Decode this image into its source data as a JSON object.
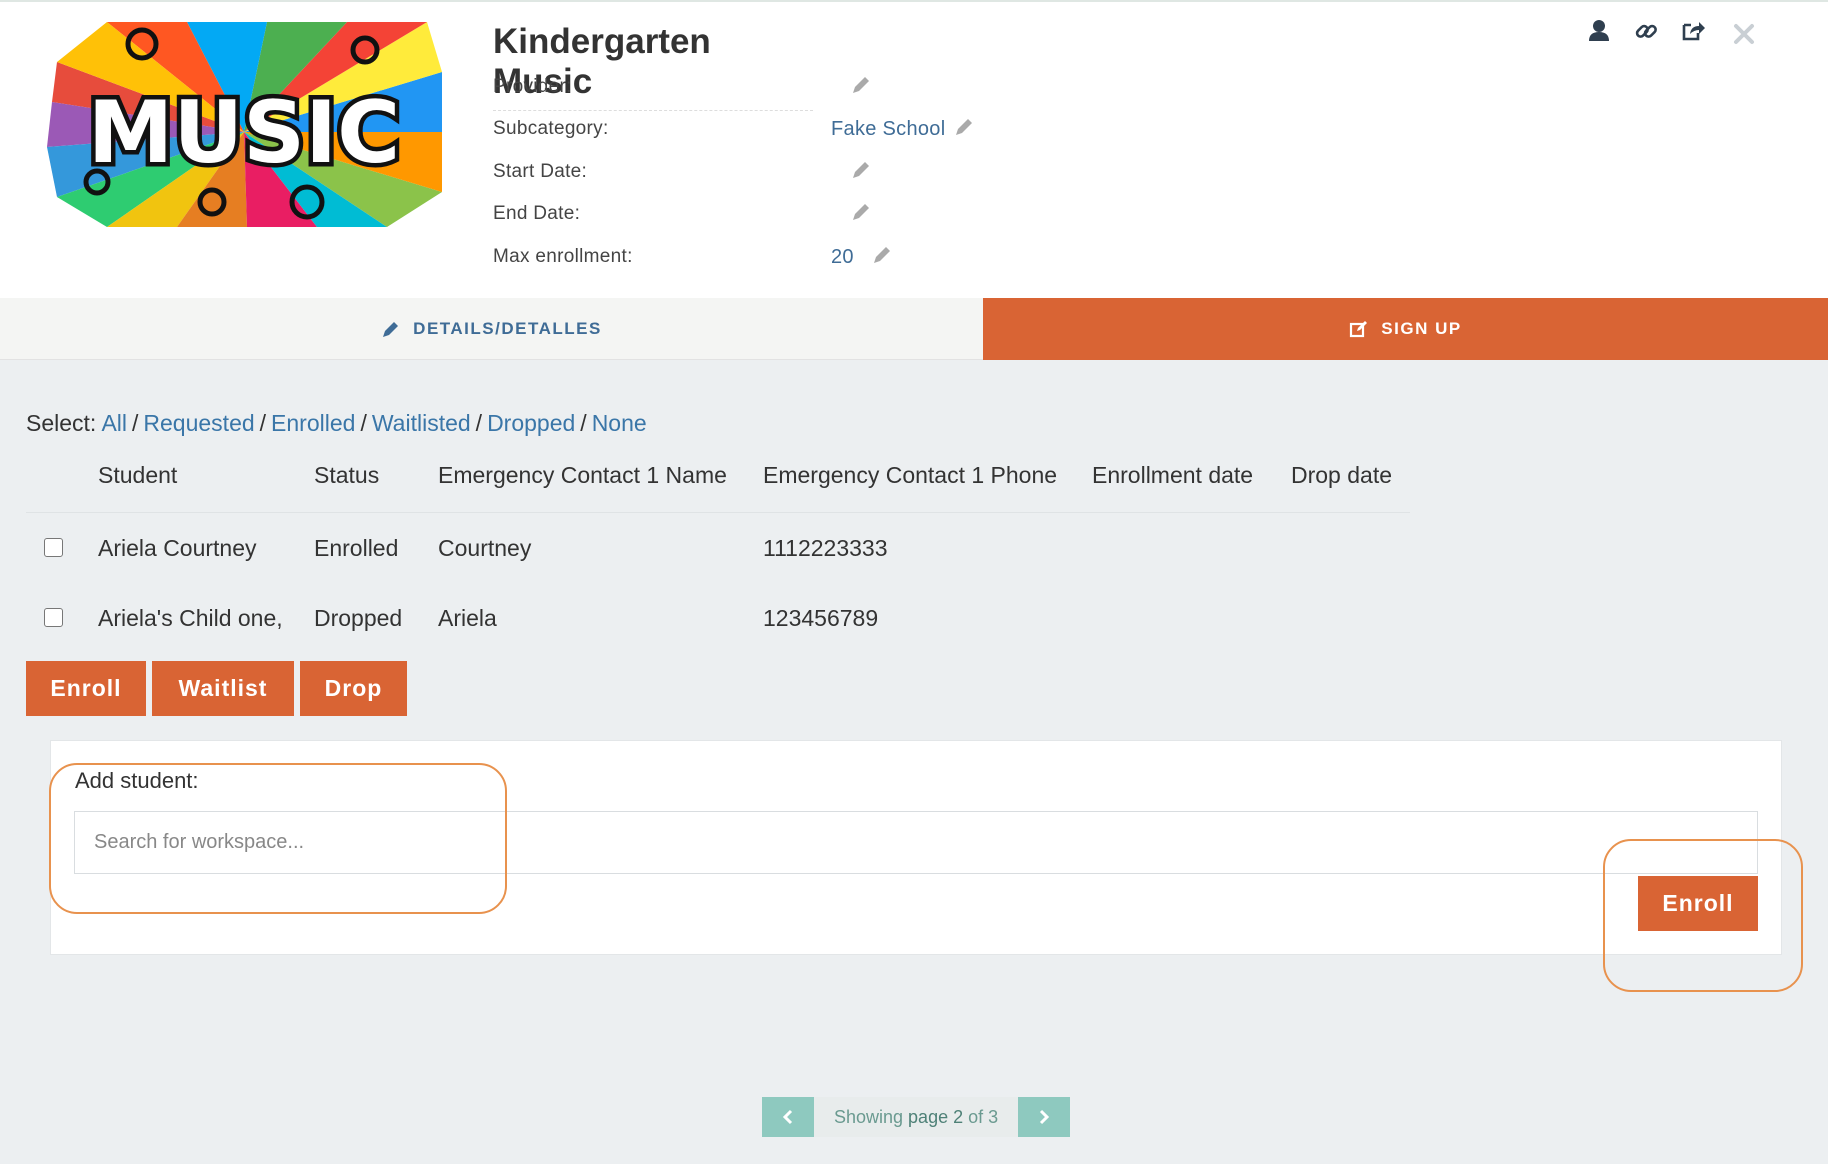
{
  "colors": {
    "accent": "#d96434",
    "link": "#3a76a8",
    "highlight": "#e8924e",
    "pager": "#8ec9bf"
  },
  "header": {
    "logo_text": "MUSIC",
    "title": "Kindergarten Music",
    "fields": {
      "provider": {
        "label": "Provider:",
        "value": ""
      },
      "subcategory": {
        "label": "Subcategory:",
        "value": "Fake School"
      },
      "start_date": {
        "label": "Start Date:",
        "value": ""
      },
      "end_date": {
        "label": "End Date:",
        "value": ""
      },
      "max_enrollment": {
        "label": "Max enrollment:",
        "value": "20"
      }
    },
    "icons": [
      "user-icon",
      "link-icon",
      "share-icon",
      "close-icon"
    ]
  },
  "tabs": {
    "details": "DETAILS/DETALLES",
    "signup": "SIGN UP"
  },
  "select": {
    "prefix": "Select:",
    "options": [
      "All",
      "Requested",
      "Enrolled",
      "Waitlisted",
      "Dropped",
      "None"
    ]
  },
  "table": {
    "headers": [
      "Student",
      "Status",
      "Emergency Contact 1 Name",
      "Emergency Contact 1 Phone",
      "Enrollment date",
      "Drop date"
    ],
    "rows": [
      {
        "student": "Ariela Courtney",
        "status": "Enrolled",
        "contact_name": "Courtney",
        "contact_phone": "1112223333",
        "enrollment_date": "",
        "drop_date": ""
      },
      {
        "student": "Ariela's Child one,",
        "status": "Dropped",
        "contact_name": "Ariela",
        "contact_phone": "123456789",
        "enrollment_date": "",
        "drop_date": ""
      }
    ]
  },
  "actions": {
    "enroll": "Enroll",
    "waitlist": "Waitlist",
    "drop": "Drop"
  },
  "add_student": {
    "label": "Add student:",
    "placeholder": "Search for workspace...",
    "enroll": "Enroll"
  },
  "pager": {
    "showing": "Showing",
    "page_label": "page 2",
    "of": "of 3"
  }
}
